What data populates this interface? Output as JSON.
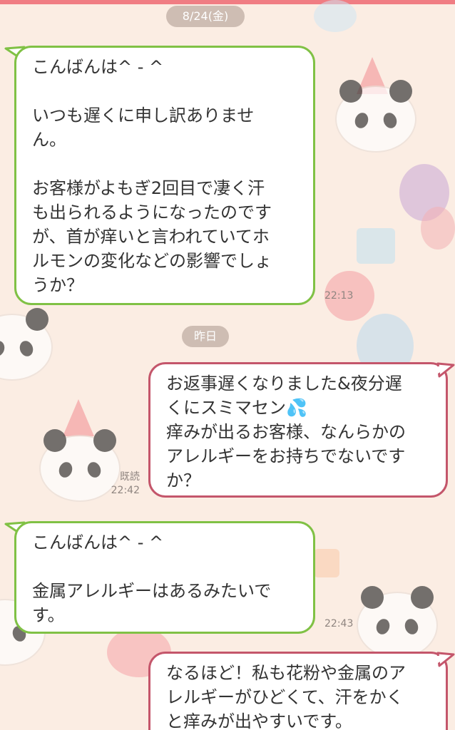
{
  "dates": {
    "first": "8/24(金)",
    "second": "昨日"
  },
  "messages": [
    {
      "direction": "in",
      "text": "こんばんは^ - ^\n\nいつも遅くに申し訳ありませ\nん。\n\nお客様がよもぎ2回目で凄く汗\nも出られるようになったのです\nが、首が痒いと言われていてホ\nルモンの変化などの影響でしょ\nうか？",
      "time": "22:13"
    },
    {
      "direction": "out",
      "text": "お返事遅くなりました&夜分遅\nくにスミマセン💦\n痒みが出るお客様、なんらかの\nアレルギーをお持ちでないです\nか？",
      "read": "既読",
      "time": "22:42"
    },
    {
      "direction": "in",
      "text": "こんばんは^ - ^\n\n金属アレルギーはあるみたいで\nす。",
      "time": "22:43"
    },
    {
      "direction": "out",
      "text": "なるほど！私も花粉や金属のア\nレルギーがひどくて、汗をかく\nと痒みが出やすいです。"
    }
  ],
  "colors": {
    "incoming_border": "#80c145",
    "outgoing_border": "#c4566b",
    "background": "#fbede3"
  }
}
